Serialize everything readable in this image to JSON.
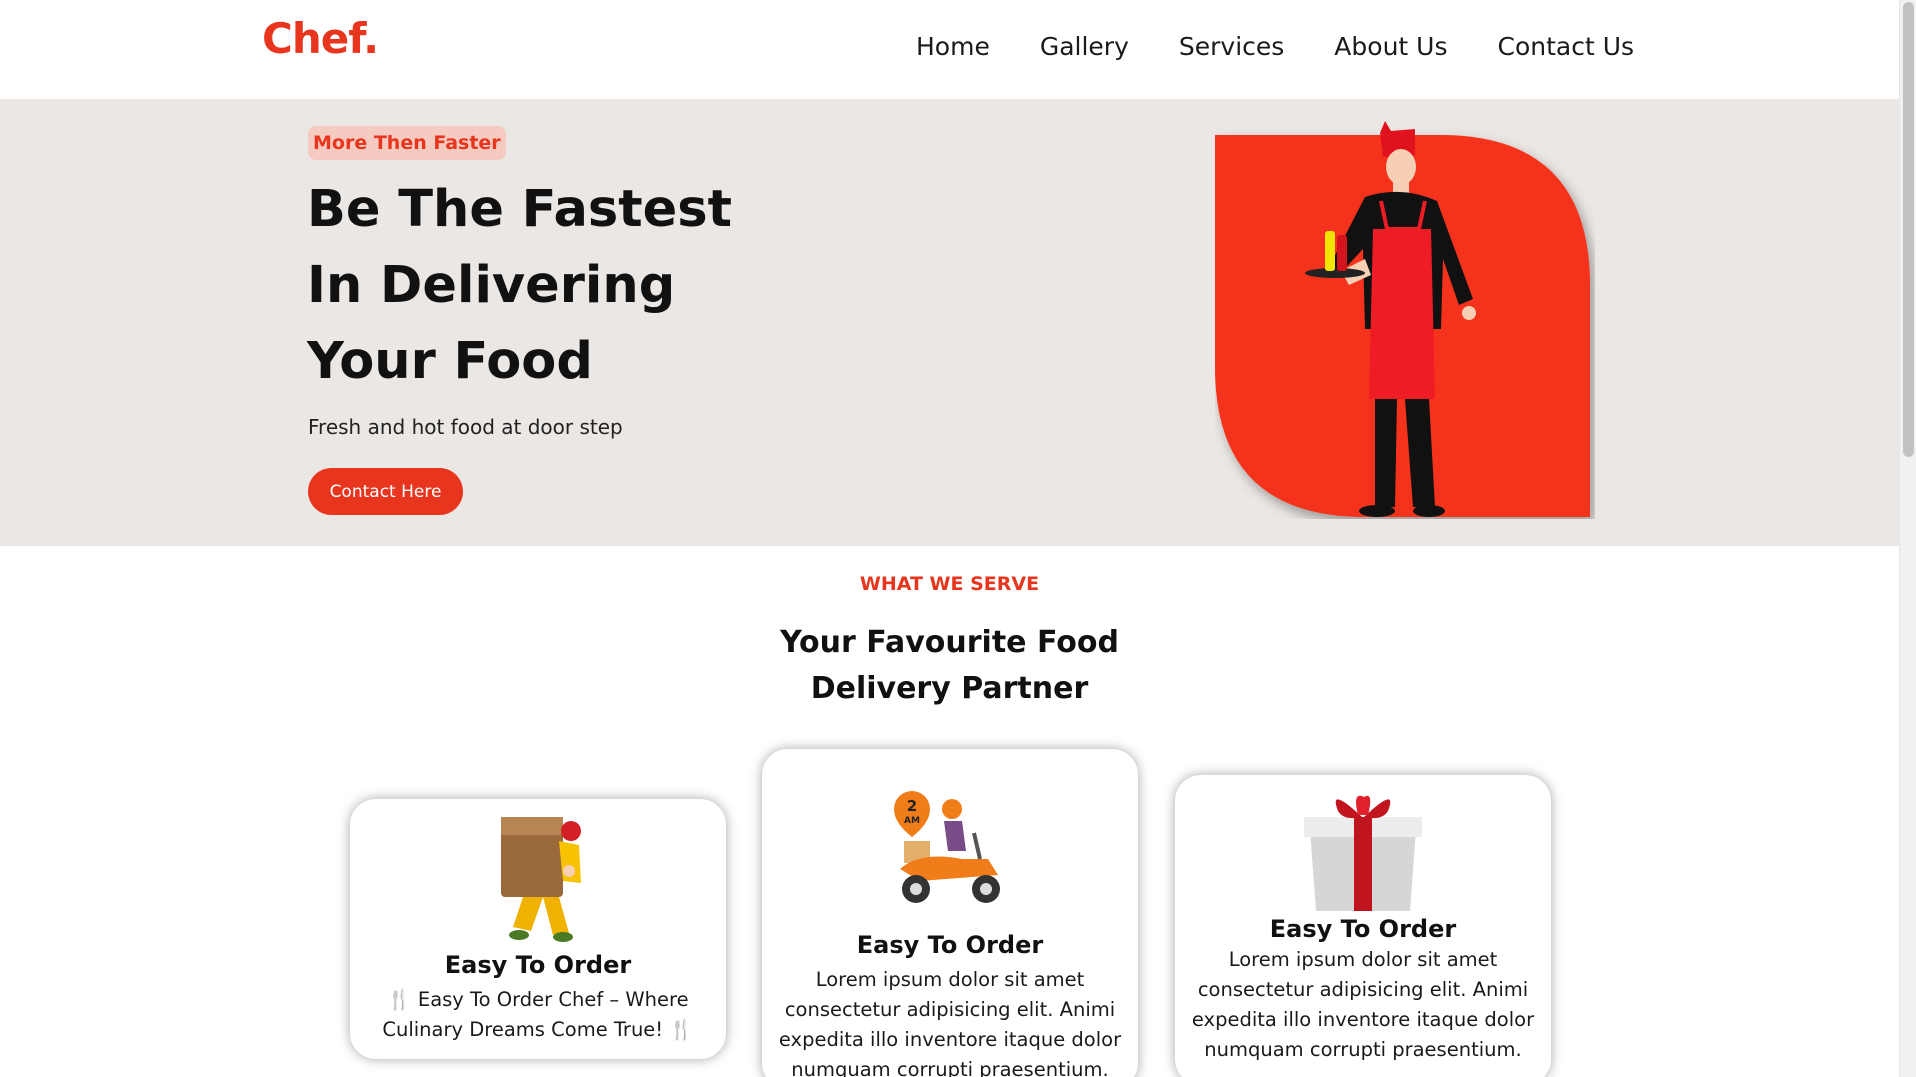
{
  "brand": {
    "logo": "Chef."
  },
  "nav": {
    "items": [
      "Home",
      "Gallery",
      "Services",
      "About Us",
      "Contact Us"
    ]
  },
  "hero": {
    "badge": "More Then Faster",
    "title_line1": "Be The Fastest",
    "title_line2": "In Delivering",
    "title_line3": "Your Food",
    "subtitle": "Fresh and hot food at door step",
    "cta_label": "Contact Here",
    "image_icon": "chef-waiter-illustration"
  },
  "services": {
    "kicker": "WHAT WE SERVE",
    "title_line1": "Your Favourite Food",
    "title_line2": "Delivery Partner",
    "cards": [
      {
        "icon": "delivery-man-carrying-box-icon",
        "title": "Easy To Order",
        "text": "🍴 Easy To Order Chef – Where Culinary Dreams Come True! 🍴"
      },
      {
        "icon": "scooter-delivery-icon",
        "icon_badge": "2 AM",
        "title": "Easy To Order",
        "text": "Lorem ipsum dolor sit amet consectetur adipisicing elit. Animi expedita illo inventore itaque dolor numquam corrupti praesentium."
      },
      {
        "icon": "gift-box-icon",
        "title": "Easy To Order",
        "text": "Lorem ipsum dolor sit amet consectetur adipisicing elit. Animi expedita illo inventore itaque dolor numquam corrupti praesentium."
      }
    ]
  },
  "colors": {
    "accent": "#e8351e",
    "hero_bg": "#ebe7e4",
    "badge_bg": "#f5cbc1"
  }
}
